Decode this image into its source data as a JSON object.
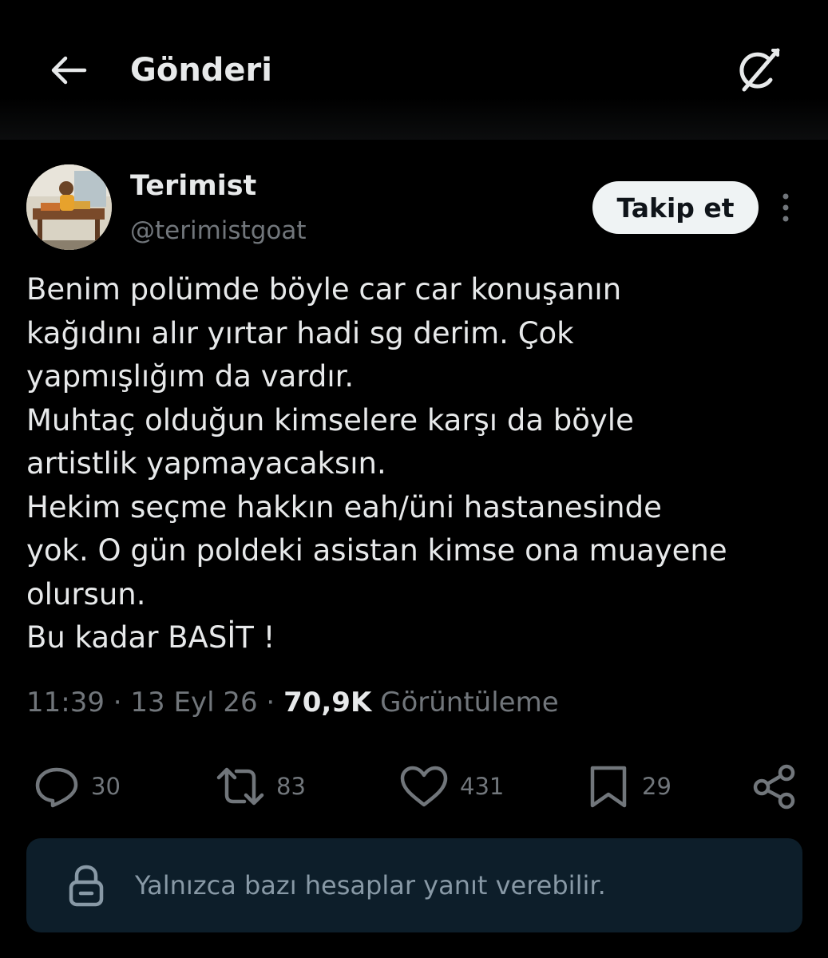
{
  "header": {
    "title": "Gönderi"
  },
  "author": {
    "name": "Terimist",
    "handle": "@terimistgoat",
    "follow_label": "Takip et"
  },
  "tweet": {
    "lines": [
      "Benim polümde böyle car car konuşanın",
      "kağıdını alır yırtar hadi sg derim. Çok",
      "yapmışlığım da vardır.",
      "Muhtaç olduğun kimselere karşı da böyle",
      "artistlik yapmayacaksın.",
      "Hekim seçme hakkın eah/üni hastanesinde",
      "yok. O gün poldeki asistan kimse ona muayene",
      "olursun.",
      "Bu kadar BASİT !"
    ]
  },
  "meta": {
    "time": "11:39",
    "separator": " · ",
    "date": "13 Eyl 26",
    "views": "70,9K",
    "views_label": "Görüntüleme"
  },
  "actions": {
    "replies": "30",
    "reposts": "83",
    "likes": "431",
    "bookmarks": "29"
  },
  "reply_restriction": {
    "text": "Yalnızca bazı hesaplar yanıt verebilir."
  },
  "icons": {
    "back": "arrow-left-icon",
    "grok": "grok-icon",
    "more": "more-vertical-icon",
    "reply": "reply-icon",
    "repost": "repost-icon",
    "like": "heart-icon",
    "bookmark": "bookmark-icon",
    "share": "share-icon",
    "lock": "lock-icon"
  },
  "colors": {
    "background": "#000000",
    "text": "#e7e9ea",
    "muted": "#71767b",
    "follow_bg": "#eff3f4",
    "reply_box_bg": "#0d1e2a"
  }
}
